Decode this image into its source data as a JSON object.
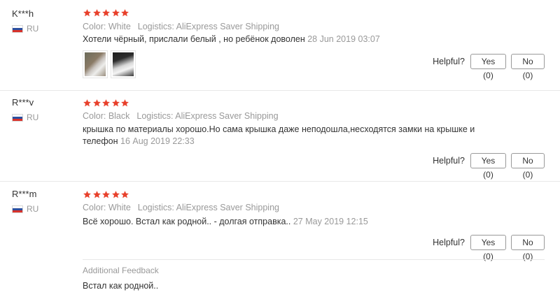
{
  "helpful_label": "Helpful?",
  "star_color": "#e8412c",
  "reviews": [
    {
      "name": "K***h",
      "country": "RU",
      "rating": 5,
      "color_label": "Color: White",
      "logistics_label": "Logistics: AliExpress Saver Shipping",
      "text": "Хотели чёрный, прислали белый , но ребёнок доволен",
      "date": "28 Jun 2019 03:07",
      "yes_label": "Yes (0)",
      "no_label": "No (0)"
    },
    {
      "name": "R***v",
      "country": "RU",
      "rating": 5,
      "color_label": "Color: Black",
      "logistics_label": "Logistics: AliExpress Saver Shipping",
      "text": "крышка по материалы хорошо.Но сама крышка даже неподошла,несходятся замки на крышке и телефон",
      "date": "16 Aug 2019 22:33",
      "yes_label": "Yes (0)",
      "no_label": "No (0)"
    },
    {
      "name": "R***m",
      "country": "RU",
      "rating": 5,
      "color_label": "Color: White",
      "logistics_label": "Logistics: AliExpress Saver Shipping",
      "text": "Всё хорошо. Встал как родной.. - долгая отправка..",
      "date": "27 May 2019 12:15",
      "yes_label": "Yes (0)",
      "no_label": "No (0)",
      "additional_feedback_label": "Additional Feedback",
      "additional_feedback_text": "Встал как родной.."
    }
  ]
}
